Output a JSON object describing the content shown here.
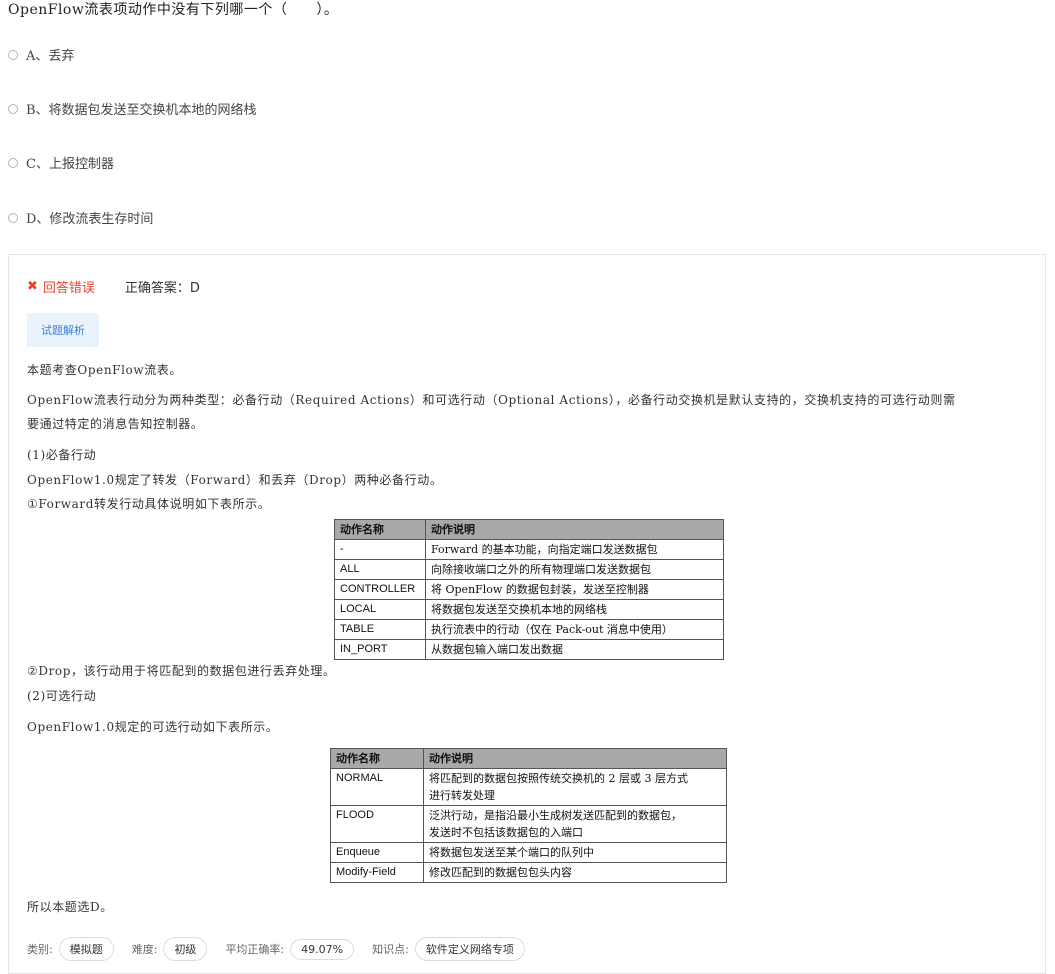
{
  "question": "OpenFlow流表项动作中没有下列哪一个（　　）。",
  "options": [
    {
      "label": "A、丢弃"
    },
    {
      "label": "B、将数据包发送至交换机本地的网络栈"
    },
    {
      "label": "C、上报控制器"
    },
    {
      "label": "D、修改流表生存时间"
    }
  ],
  "result": {
    "status": "回答错误",
    "correct_answer": "正确答案：D"
  },
  "analysis_tab": "试题解析",
  "explanation": {
    "p1": "本题考查OpenFlow流表。",
    "p2a": "OpenFlow流表行动分为两种类型：必备行动（Required Actions）和可选行动（Optional Actions），必备行动交换机是默认支持的，交换机支持的可选行动则需",
    "p2b": "要通过特定的消息告知控制器。",
    "p3": "(1)必备行动",
    "p4": "OpenFlow1.0规定了转发（Forward）和丢弃（Drop）两种必备行动。",
    "p5": "①Forward转发行动具体说明如下表所示。",
    "p6": "②Drop，该行动用于将匹配到的数据包进行丢弃处理。",
    "p7": "(2)可选行动",
    "p8": "OpenFlow1.0规定的可选行动如下表所示。",
    "p9": "所以本题选D。"
  },
  "table1": {
    "headers": [
      "动作名称",
      "动作说明"
    ],
    "rows": [
      [
        "-",
        "Forward 的基本功能，向指定端口发送数据包"
      ],
      [
        "ALL",
        "向除接收端口之外的所有物理端口发送数据包"
      ],
      [
        "CONTROLLER",
        "将 OpenFlow 的数据包封装，发送至控制器"
      ],
      [
        "LOCAL",
        "将数据包发送至交换机本地的网络栈"
      ],
      [
        "TABLE",
        "执行流表中的行动（仅在 Pack-out 消息中使用）"
      ],
      [
        "IN_PORT",
        "从数据包输入端口发出数据"
      ]
    ]
  },
  "table2": {
    "headers": [
      "动作名称",
      "动作说明"
    ],
    "rows": [
      [
        "NORMAL",
        "将匹配到的数据包按照传统交换机的 2 层或 3 层方式",
        "进行转发处理"
      ],
      [
        "FLOOD",
        "泛洪行动，是指沿最小生成树发送匹配到的数据包，",
        "发送时不包括该数据包的入端口"
      ],
      [
        "Enqueue",
        "将数据包发送至某个端口的队列中",
        ""
      ],
      [
        "Modify-Field",
        "修改匹配到的数据包包头内容",
        ""
      ]
    ]
  },
  "meta": {
    "category_label": "类别:",
    "category_value": "模拟题",
    "difficulty_label": "难度:",
    "difficulty_value": "初级",
    "accuracy_label": "平均正确率:",
    "accuracy_value": "49.07%",
    "knowledge_label": "知识点:",
    "knowledge_value": "软件定义网络专项"
  },
  "colors": {
    "wrong": "#e8442c",
    "tab_bg": "#eaf2fd",
    "tab_text": "#3d7fd6",
    "table_header": "#a9a9a9"
  }
}
